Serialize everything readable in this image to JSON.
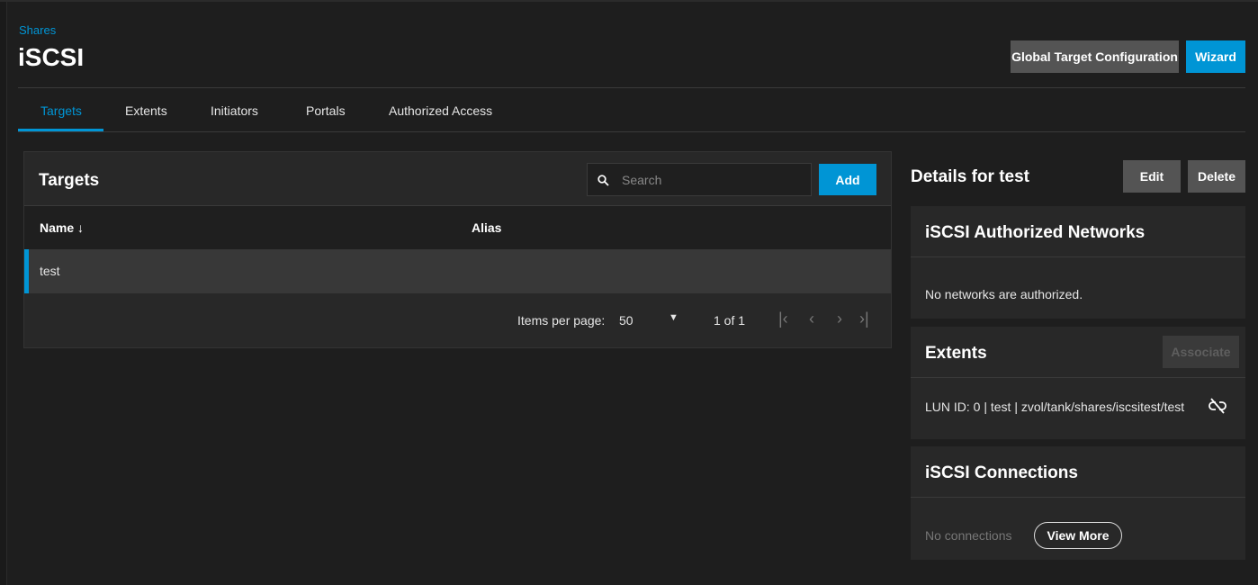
{
  "breadcrumb": "Shares",
  "page_title": "iSCSI",
  "header_buttons": {
    "global_config": "Global Target Configuration",
    "wizard": "Wizard"
  },
  "tabs": [
    {
      "label": "Targets",
      "active": true
    },
    {
      "label": "Extents"
    },
    {
      "label": "Initiators"
    },
    {
      "label": "Portals"
    },
    {
      "label": "Authorized Access"
    }
  ],
  "targets": {
    "title": "Targets",
    "search_placeholder": "Search",
    "add_label": "Add",
    "columns": [
      "Name",
      "Alias"
    ],
    "sort_icon": "arrow-down-icon",
    "rows": [
      {
        "name": "test",
        "alias": ""
      }
    ],
    "paginator": {
      "items_label": "Items per page:",
      "page_size": "50",
      "range": "1 of 1"
    }
  },
  "details": {
    "title": "Details for test",
    "edit_label": "Edit",
    "delete_label": "Delete",
    "networks": {
      "title": "iSCSI Authorized Networks",
      "empty": "No networks are authorized."
    },
    "extents": {
      "title": "Extents",
      "associate_label": "Associate",
      "items": [
        "LUN ID: 0 | test | zvol/tank/shares/iscsitest/test"
      ]
    },
    "connections": {
      "title": "iSCSI Connections",
      "empty": "No connections",
      "view_more": "View More"
    }
  },
  "colors": {
    "accent": "#0095d5",
    "card": "#282828",
    "background": "#1e1e1e"
  }
}
